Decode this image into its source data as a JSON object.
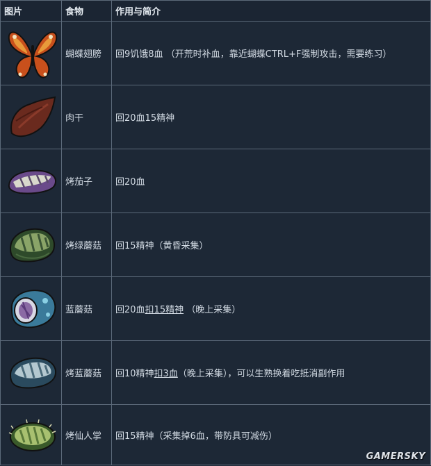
{
  "header": {
    "col_image": "图片",
    "col_food": "食物",
    "col_desc": "作用与简介"
  },
  "rows": [
    {
      "name": "蝴蝶翅膀",
      "icon": "butterfly-wings-icon",
      "desc": {
        "a": "回9饥饿8血 （开荒时补血，靠近蝴蝶CTRL+F强制攻击，需要练习）"
      }
    },
    {
      "name": "肉干",
      "icon": "jerky-icon",
      "desc": {
        "a": "回20血15精神"
      }
    },
    {
      "name": "烤茄子",
      "icon": "roasted-eggplant-icon",
      "desc": {
        "a": "回20血"
      }
    },
    {
      "name": "烤绿蘑菇",
      "icon": "roasted-green-mushroom-icon",
      "desc": {
        "a": "回15精神（黄昏采集）"
      }
    },
    {
      "name": "蓝蘑菇",
      "icon": "blue-mushroom-icon",
      "desc": {
        "a": "回20血",
        "u": "扣15精神",
        "b": " （晚上采集）"
      }
    },
    {
      "name": "烤蓝蘑菇",
      "icon": "roasted-blue-mushroom-icon",
      "desc": {
        "a": "回10精神",
        "u": "扣3血",
        "b": "（晚上采集），可以生熟换着吃抵消副作用"
      }
    },
    {
      "name": "烤仙人掌",
      "icon": "roasted-cactus-icon",
      "desc": {
        "a": "回15精神（采集掉6血，带防具可减伤）"
      }
    }
  ],
  "watermark": "GAMERSKY"
}
